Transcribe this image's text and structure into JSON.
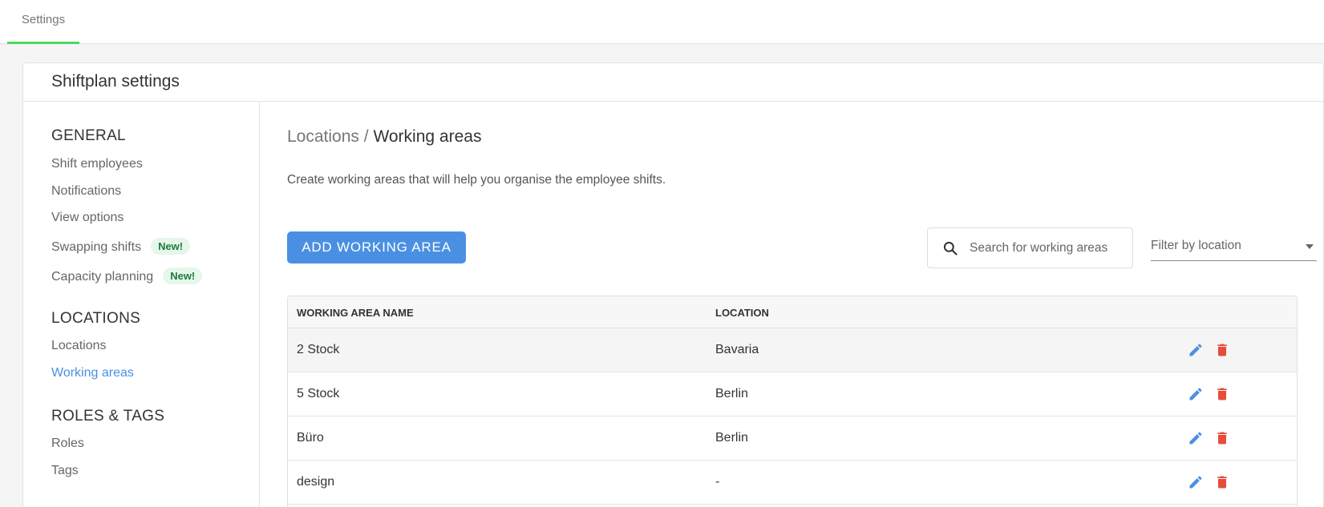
{
  "topnav": {
    "tab_settings": "Settings"
  },
  "card": {
    "title": "Shiftplan settings"
  },
  "sidebar": {
    "general_heading": "GENERAL",
    "shift_employees": "Shift employees",
    "notifications": "Notifications",
    "view_options": "View options",
    "swapping_shifts": "Swapping shifts",
    "capacity_planning": "Capacity planning",
    "new_badge": "New!",
    "locations_heading": "LOCATIONS",
    "locations": "Locations",
    "working_areas": "Working areas",
    "roles_tags_heading": "ROLES & TAGS",
    "roles": "Roles",
    "tags": "Tags"
  },
  "main": {
    "breadcrumb_parent": "Locations",
    "breadcrumb_sep": "/",
    "breadcrumb_current": "Working areas",
    "description": "Create working areas that will help you organise the employee shifts.",
    "add_button": "ADD WORKING AREA",
    "search_placeholder": "Search for working areas",
    "filter_label": "Filter by location"
  },
  "table": {
    "col_name": "WORKING AREA NAME",
    "col_location": "LOCATION",
    "rows": [
      {
        "name": "2 Stock",
        "location": "Bavaria"
      },
      {
        "name": "5 Stock",
        "location": "Berlin"
      },
      {
        "name": "Büro",
        "location": "Berlin"
      },
      {
        "name": "design",
        "location": "-"
      }
    ]
  },
  "colors": {
    "accent": "#4a90e2",
    "delete": "#e74c3c",
    "tab_underline": "#4cd964",
    "badge_bg": "#e6f7ea"
  },
  "icons": {
    "search": "search-icon",
    "edit": "pencil-icon",
    "delete": "trash-icon",
    "dropdown": "chevron-down-icon"
  }
}
